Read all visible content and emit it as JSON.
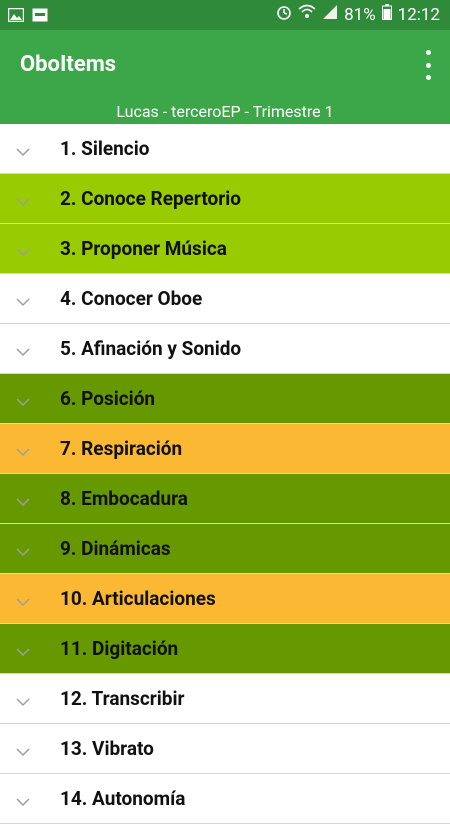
{
  "status_bar": {
    "battery": "81%",
    "time": "12:12"
  },
  "app_bar": {
    "title": "OboItems"
  },
  "subtitle": "Lucas - terceroEP - Trimestre 1",
  "colors": {
    "status_bar": "#2f8a3a",
    "app_bar": "#3ca749",
    "light_green": "#99cc00",
    "dark_green": "#669900",
    "orange": "#fbb832",
    "white": "#ffffff"
  },
  "items": [
    {
      "label": "1. Silencio",
      "color": "#ffffff"
    },
    {
      "label": "2. Conoce Repertorio",
      "color": "#99cc00"
    },
    {
      "label": "3. Proponer Música",
      "color": "#99cc00"
    },
    {
      "label": "4. Conocer Oboe",
      "color": "#ffffff"
    },
    {
      "label": "5. Afinación y Sonido",
      "color": "#ffffff"
    },
    {
      "label": "6. Posición",
      "color": "#669900"
    },
    {
      "label": "7. Respiración",
      "color": "#fbb832"
    },
    {
      "label": "8. Embocadura",
      "color": "#669900"
    },
    {
      "label": "9. Dinámicas",
      "color": "#669900"
    },
    {
      "label": "10. Articulaciones",
      "color": "#fbb832"
    },
    {
      "label": "11. Digitación",
      "color": "#669900"
    },
    {
      "label": "12. Transcribir",
      "color": "#ffffff"
    },
    {
      "label": "13. Vibrato",
      "color": "#ffffff"
    },
    {
      "label": "14. Autonomía",
      "color": "#ffffff"
    }
  ]
}
